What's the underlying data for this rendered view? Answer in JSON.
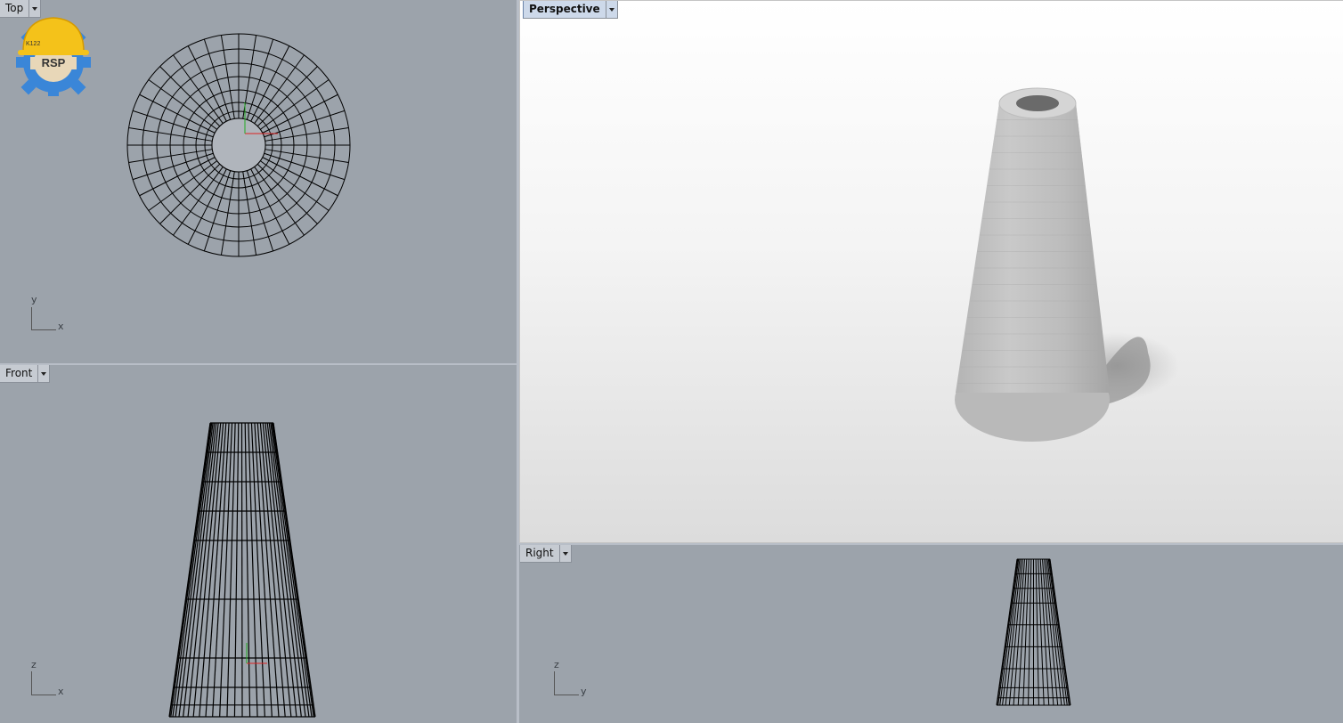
{
  "viewports": {
    "top": {
      "label": "Top",
      "axis_v": "y",
      "axis_h": "x"
    },
    "front": {
      "label": "Front",
      "axis_v": "z",
      "axis_h": "x"
    },
    "perspective": {
      "label": "Perspective"
    },
    "right": {
      "label": "Right",
      "axis_v": "z",
      "axis_h": "y"
    }
  },
  "logo": {
    "text": "RSP",
    "badge": "K122",
    "icon": "hardhat-gear-logo"
  },
  "colors": {
    "viewport_bg": "#9ca3ab",
    "active_tab": "#cdd9ea",
    "wire": "#000000",
    "concrete": "#bdbdbd"
  }
}
